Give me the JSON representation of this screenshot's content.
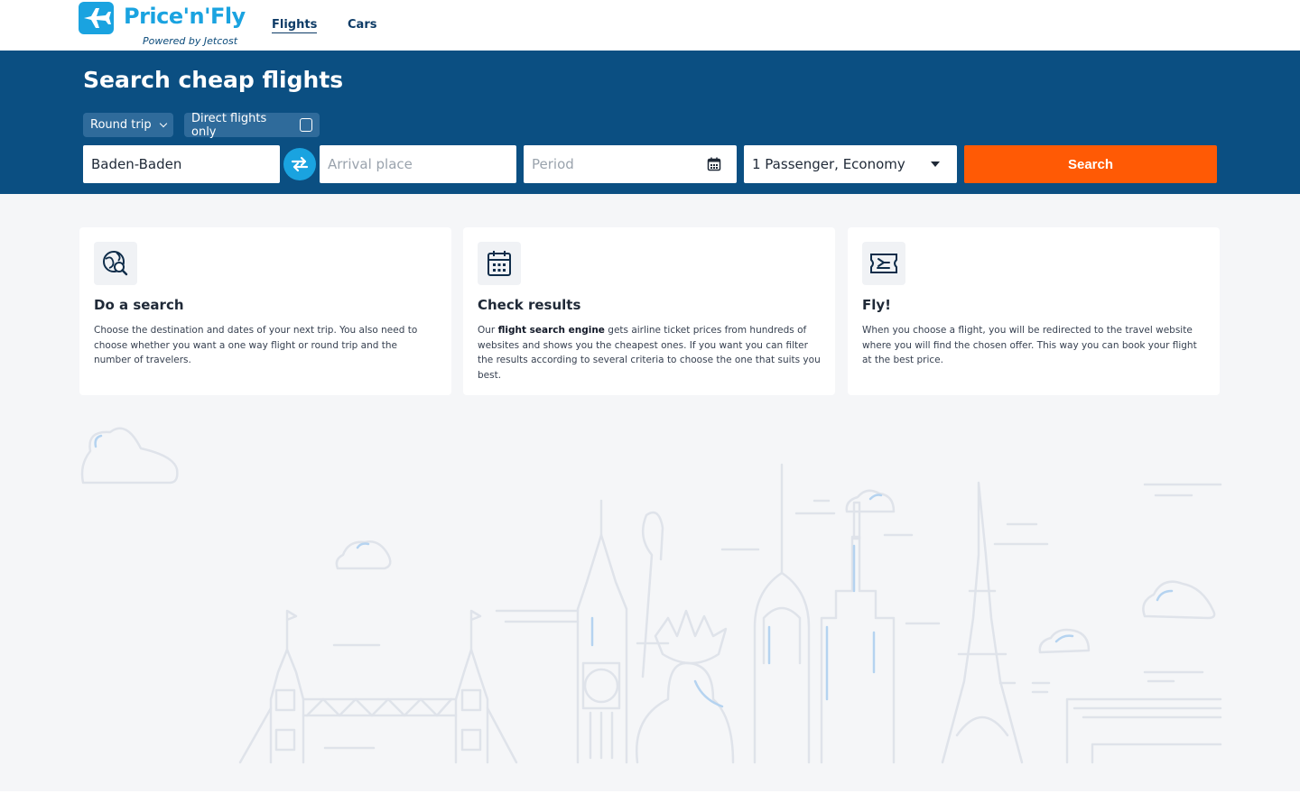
{
  "header": {
    "logo_text": "Price'n'Fly",
    "logo_sub": "Powered by Jetcost",
    "nav": [
      {
        "label": "Flights",
        "active": true
      },
      {
        "label": "Cars",
        "active": false
      }
    ]
  },
  "search": {
    "title": "Search cheap flights",
    "trip_type": "Round trip",
    "direct_label": "Direct flights only",
    "direct_checked": false,
    "origin_value": "Baden-Baden",
    "arrival_placeholder": "Arrival place",
    "period_placeholder": "Period",
    "passengers_value": "1 Passenger, Economy",
    "search_label": "Search"
  },
  "steps": [
    {
      "icon": "globe-search-icon",
      "title": "Do a search",
      "text": "Choose the destination and dates of your next trip. You also need to choose whether you want a one way flight or round trip and the number of travelers."
    },
    {
      "icon": "calendar-icon",
      "title": "Check results",
      "text_before": "Our ",
      "text_bold": "flight search engine",
      "text_after": " gets airline ticket prices from hundreds of websites and shows you the cheapest ones. If you want you can filter the results according to several criteria to choose the one that suits you best."
    },
    {
      "icon": "boarding-pass-icon",
      "title": "Fly!",
      "text": "When you choose a flight, you will be redirected to the travel website where you will find the chosen offer. This way you can book your flight at the best price."
    }
  ],
  "colors": {
    "brand_blue": "#1aa3e0",
    "hero_bg": "#0b4f82",
    "search_orange": "#ff5a05",
    "content_bg": "#f5f6f8"
  }
}
